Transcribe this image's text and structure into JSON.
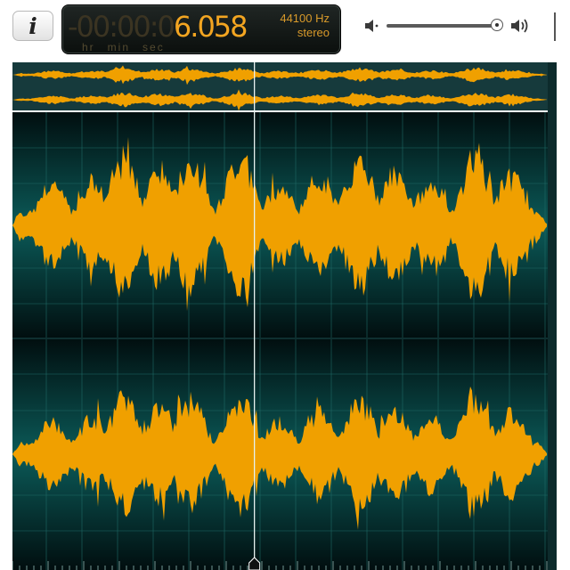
{
  "toolbar": {
    "info_icon": "info-icon",
    "info_label": "i",
    "time": {
      "dim_digits": "-00:00:0",
      "value": "6.058",
      "units": [
        "hr",
        "min",
        "sec"
      ]
    },
    "sample_rate": "44100 Hz",
    "channels": "stereo",
    "volume": {
      "low_icon": "speaker-low-icon",
      "high_icon": "speaker-high-icon",
      "level": 0.95
    }
  },
  "waveform": {
    "background": "#063b3a",
    "wave_color": "#f0a000",
    "playhead_fraction": 0.452,
    "channel_count": 2
  },
  "colors": {
    "display_digits": "#f3a521",
    "display_background": "#151a18"
  }
}
